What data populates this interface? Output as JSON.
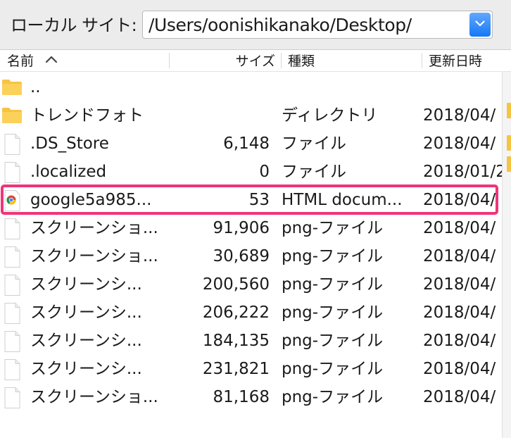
{
  "local_site": {
    "label": "ローカル サイト:",
    "path": "/Users/oonishikanako/Desktop/"
  },
  "columns": {
    "name": "名前",
    "size": "サイズ",
    "kind": "種類",
    "modified": "更新日時",
    "sort_icon": "chevron-up-icon"
  },
  "files": [
    {
      "icon": "folder-icon",
      "name": "..",
      "size": "",
      "kind": "",
      "modified": ""
    },
    {
      "icon": "folder-icon",
      "name": "トレンドフォト",
      "size": "",
      "kind": "ディレクトリ",
      "modified": "2018/04/"
    },
    {
      "icon": "file-icon",
      "name": ".DS_Store",
      "size": "6,148",
      "kind": "ファイル",
      "modified": "2018/04/"
    },
    {
      "icon": "file-icon",
      "name": ".localized",
      "size": "0",
      "kind": "ファイル",
      "modified": "2018/01/2"
    },
    {
      "icon": "chrome-icon",
      "name": "google5a985...",
      "size": "53",
      "kind": "HTML docum...",
      "modified": "2018/04/"
    },
    {
      "icon": "file-icon",
      "name": "スクリーンショ...",
      "size": "91,906",
      "kind": "png-ファイル",
      "modified": "2018/04/"
    },
    {
      "icon": "file-icon",
      "name": "スクリーンショ...",
      "size": "30,689",
      "kind": "png-ファイル",
      "modified": "2018/04/"
    },
    {
      "icon": "file-icon",
      "name": "スクリーンシ...",
      "size": "200,560",
      "kind": "png-ファイル",
      "modified": "2018/04/"
    },
    {
      "icon": "file-icon",
      "name": "スクリーンシ...",
      "size": "206,222",
      "kind": "png-ファイル",
      "modified": "2018/04/"
    },
    {
      "icon": "file-icon",
      "name": "スクリーンシ...",
      "size": "184,135",
      "kind": "png-ファイル",
      "modified": "2018/04/"
    },
    {
      "icon": "file-icon",
      "name": "スクリーンシ...",
      "size": "231,821",
      "kind": "png-ファイル",
      "modified": "2018/04/"
    },
    {
      "icon": "file-icon",
      "name": "スクリーンショ...",
      "size": "81,168",
      "kind": "png-ファイル",
      "modified": "2018/04/"
    }
  ],
  "highlight_color": "#f0347a",
  "accent_color": "#1578f5",
  "folder_color": "#f6c343"
}
